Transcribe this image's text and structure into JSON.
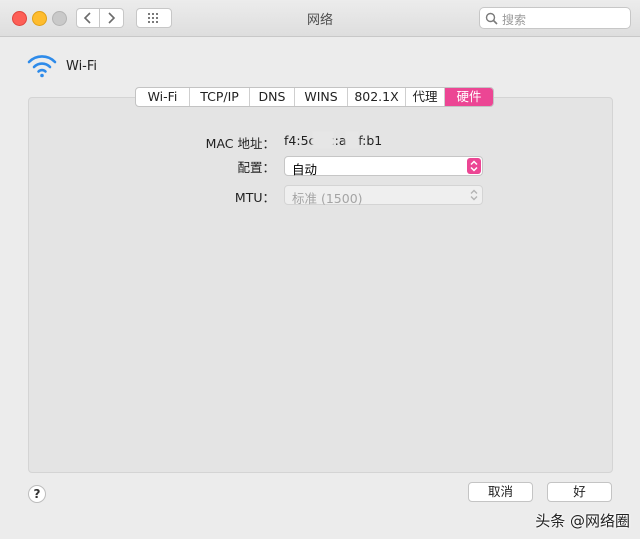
{
  "window": {
    "title": "网络"
  },
  "search": {
    "placeholder": "搜索"
  },
  "header": {
    "label": "Wi-Fi"
  },
  "tabs": [
    {
      "label": "Wi-Fi"
    },
    {
      "label": "TCP/IP"
    },
    {
      "label": "DNS"
    },
    {
      "label": "WINS"
    },
    {
      "label": "802.1X"
    },
    {
      "label": "代理"
    },
    {
      "label": "硬件",
      "active": true
    }
  ],
  "form": {
    "mac": {
      "label": "MAC 地址：",
      "value": "f4:5c:   :c:ae   f:b1"
    },
    "config": {
      "label": "配置：",
      "value": "自动"
    },
    "mtu": {
      "label": "MTU：",
      "value": "标准 (1500)"
    }
  },
  "buttons": {
    "help": "?",
    "cancel": "取消",
    "ok": "好"
  },
  "watermark": {
    "text": "头条 @网络圈"
  },
  "colors": {
    "accent": "#ec4694",
    "wifi": "#2e8bea"
  }
}
